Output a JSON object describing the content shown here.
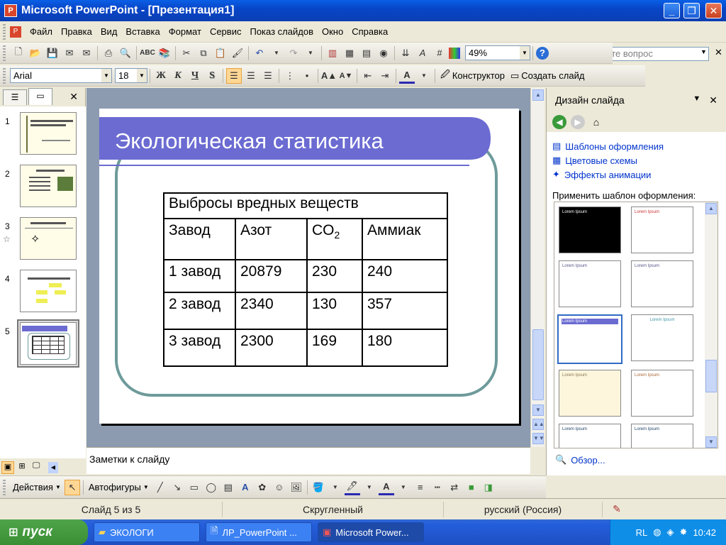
{
  "window": {
    "title": "Microsoft PowerPoint - [Презентация1]"
  },
  "menu": {
    "items": [
      "Файл",
      "Правка",
      "Вид",
      "Вставка",
      "Формат",
      "Сервис",
      "Показ слайдов",
      "Окно",
      "Справка"
    ],
    "ask_placeholder": "Введите вопрос"
  },
  "standard_toolbar": {
    "zoom": "49%"
  },
  "format_toolbar": {
    "font": "Arial",
    "size": "18",
    "bold": "Ж",
    "italic": "К",
    "underline": "Ч",
    "shadow": "S",
    "designer": "Конструктор",
    "new_slide": "Создать слайд"
  },
  "slides_panel": {
    "numbers": [
      "1",
      "2",
      "3",
      "4",
      "5"
    ],
    "selected": 5
  },
  "slide": {
    "title": "Экологическая статистика",
    "table": {
      "header_full": "Выбросы вредных веществ",
      "columns": [
        "Завод",
        "Азот",
        "CO",
        "2",
        "Аммиак"
      ],
      "rows": [
        [
          "1 завод",
          "20879",
          "230",
          "240"
        ],
        [
          "2 завод",
          "2340",
          "130",
          "357"
        ],
        [
          "3 завод",
          "2300",
          "169",
          "180"
        ]
      ]
    }
  },
  "notes": {
    "placeholder": "Заметки к слайду"
  },
  "task_pane": {
    "title": "Дизайн слайда",
    "links": [
      "Шаблоны оформления",
      "Цветовые схемы",
      "Эффекты анимации"
    ],
    "apply_label": "Применить шаблон оформления:",
    "browse": "Обзор...",
    "template_text": "Lorem Ipsum"
  },
  "drawing_toolbar": {
    "actions": "Действия",
    "autoshapes": "Автофигуры"
  },
  "status": {
    "slide": "Слайд 5 из 5",
    "design": "Скругленный",
    "language": "русский (Россия)"
  },
  "taskbar": {
    "start": "пуск",
    "tasks": [
      "ЭКОЛОГИ",
      "ЛР_PowerPoint ...",
      "Microsoft Power..."
    ],
    "lang": "RL",
    "time": "10:42"
  },
  "colors": {
    "accent": "#6b6bd2",
    "frame": "#6e9a9a",
    "xp_blue": "#0a5fe6"
  }
}
